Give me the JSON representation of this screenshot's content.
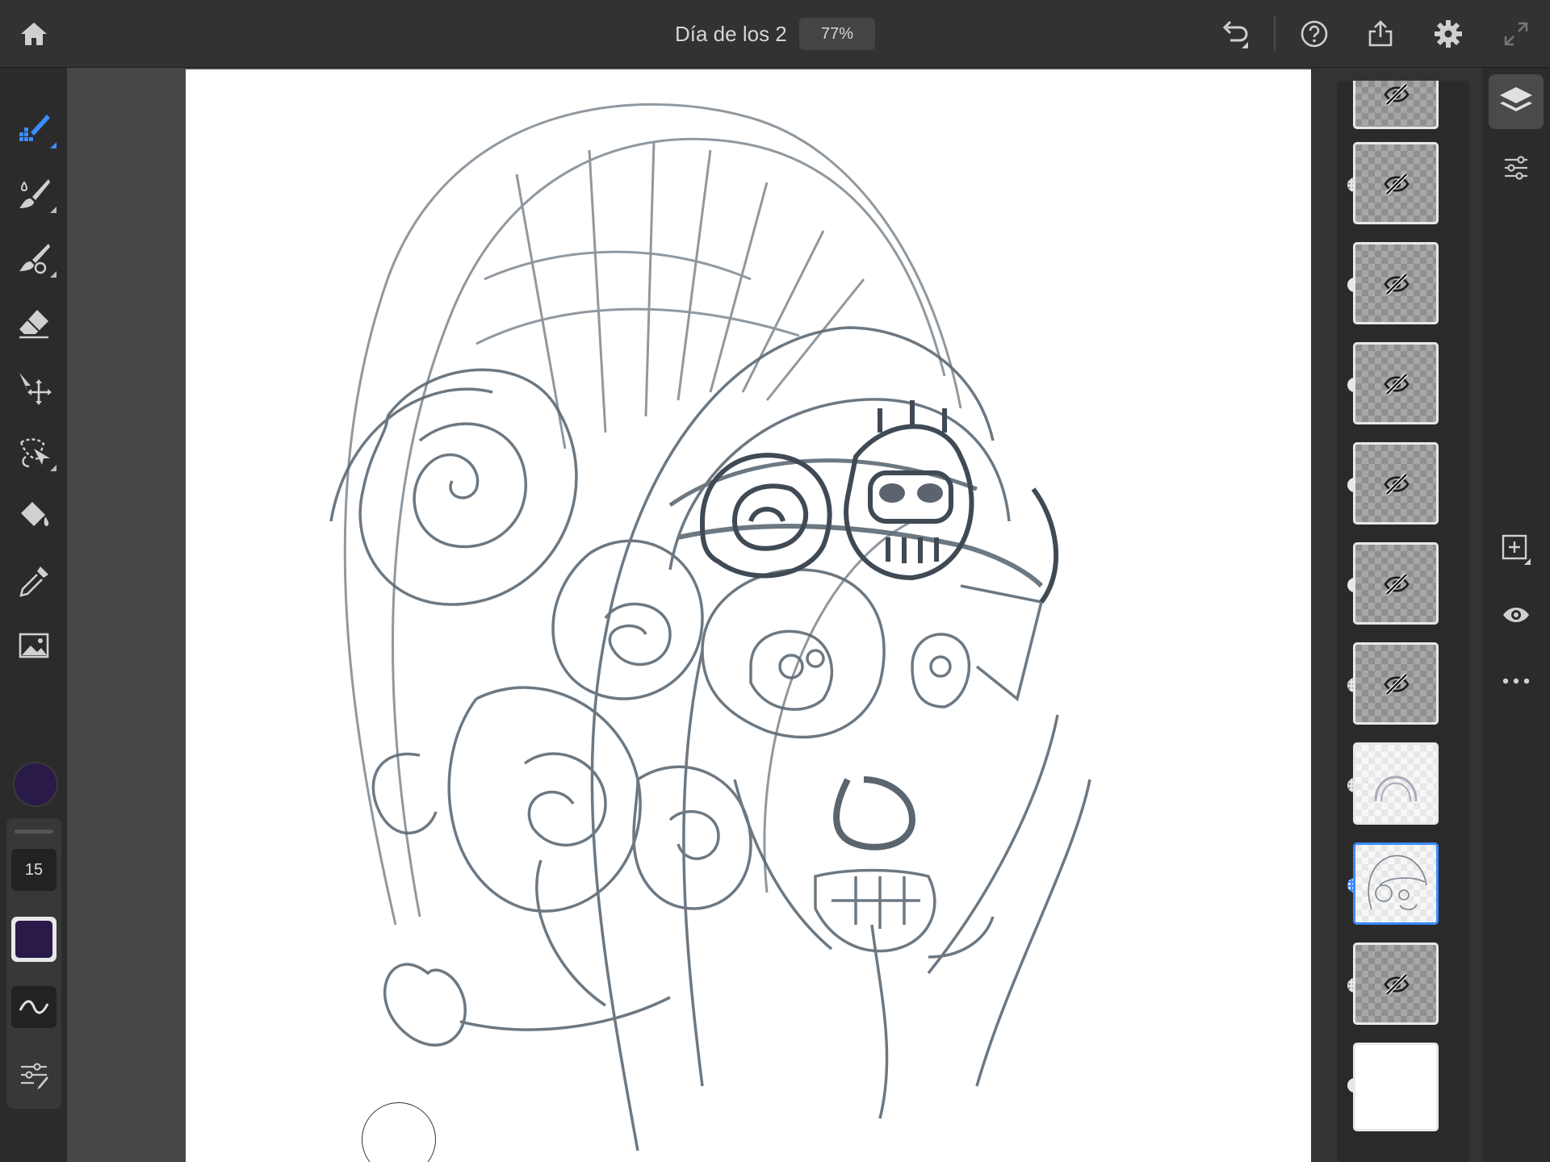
{
  "document": {
    "title": "Día de los 2",
    "zoom": "77%"
  },
  "top_toolbar": {
    "home": "home-icon",
    "undo": "undo-icon",
    "help": "help-icon",
    "share": "share-icon",
    "settings": "gear-icon",
    "fullscreen": "fullscreen-icon"
  },
  "tools": [
    {
      "name": "pixel-brush-tool",
      "icon": "pixel-brush-icon",
      "active": true
    },
    {
      "name": "live-brush-tool",
      "icon": "watercolor-brush-icon",
      "active": false
    },
    {
      "name": "mixer-brush-tool",
      "icon": "mixer-brush-icon",
      "active": false
    },
    {
      "name": "eraser-tool",
      "icon": "eraser-icon",
      "active": false
    },
    {
      "name": "transform-tool",
      "icon": "move-icon",
      "active": false
    },
    {
      "name": "selection-tool",
      "icon": "lasso-icon",
      "active": false
    },
    {
      "name": "fill-tool",
      "icon": "paint-bucket-icon",
      "active": false
    },
    {
      "name": "eyedropper-tool",
      "icon": "eyedropper-icon",
      "active": false
    },
    {
      "name": "image-tool",
      "icon": "image-icon",
      "active": false
    }
  ],
  "brush_properties": {
    "size": "15",
    "color": "#2a1a4a",
    "accent": "#3b8cff"
  },
  "layers": [
    {
      "visible": false,
      "selected": false
    },
    {
      "visible": false,
      "selected": false
    },
    {
      "visible": false,
      "selected": false
    },
    {
      "visible": false,
      "selected": false
    },
    {
      "visible": false,
      "selected": false
    },
    {
      "visible": false,
      "selected": false
    },
    {
      "visible": false,
      "selected": false
    },
    {
      "visible": true,
      "selected": false
    },
    {
      "visible": true,
      "selected": true
    },
    {
      "visible": false,
      "selected": false
    },
    {
      "visible": true,
      "selected": false
    }
  ],
  "right_rail": {
    "layers": "layers-icon",
    "layer_properties": "sliders-icon",
    "add_layer": "add-layer-icon",
    "visibility": "eye-icon",
    "more": "more-icon"
  }
}
